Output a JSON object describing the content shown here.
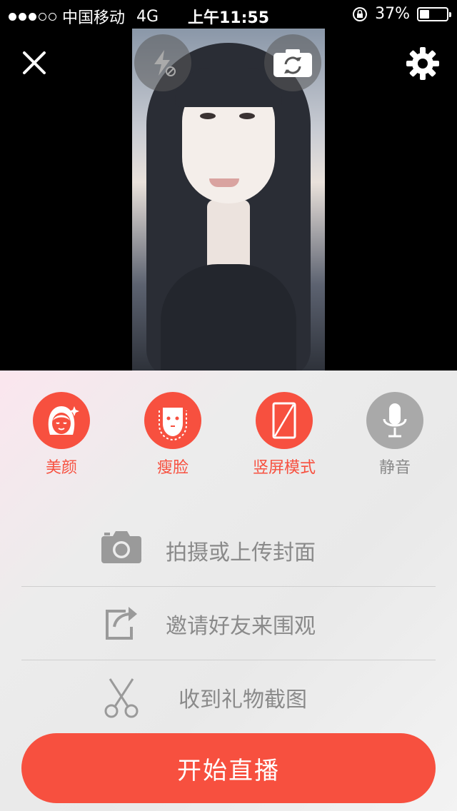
{
  "status_bar": {
    "signal_filled": 3,
    "signal_empty": 2,
    "carrier": "中国移动",
    "network": "4G",
    "time": "上午11:55",
    "battery_percent": "37%",
    "battery_level": 0.37
  },
  "top_controls": {
    "close_icon": "close-icon",
    "flash_icon": "flash-off-icon",
    "camera_switch_icon": "camera-switch-icon",
    "settings_icon": "gear-icon"
  },
  "features": [
    {
      "label": "美颜",
      "icon": "beauty-icon",
      "color": "#f7503f",
      "active": true
    },
    {
      "label": "瘦脸",
      "icon": "slim-face-icon",
      "color": "#f7503f",
      "active": true
    },
    {
      "label": "竖屏模式",
      "icon": "portrait-mode-icon",
      "color": "#f7503f",
      "active": true
    },
    {
      "label": "静音",
      "icon": "microphone-icon",
      "color": "#a9a9a9",
      "active": false
    }
  ],
  "actions": [
    {
      "label": "拍摄或上传封面",
      "icon": "camera-icon"
    },
    {
      "label": "邀请好友来围观",
      "icon": "share-icon"
    },
    {
      "label": "收到礼物截图",
      "icon": "scissors-icon"
    }
  ],
  "start_button": {
    "label": "开始直播"
  },
  "colors": {
    "accent": "#f7503f",
    "inactive": "#a9a9a9",
    "text_gray": "#8a8a8a"
  }
}
